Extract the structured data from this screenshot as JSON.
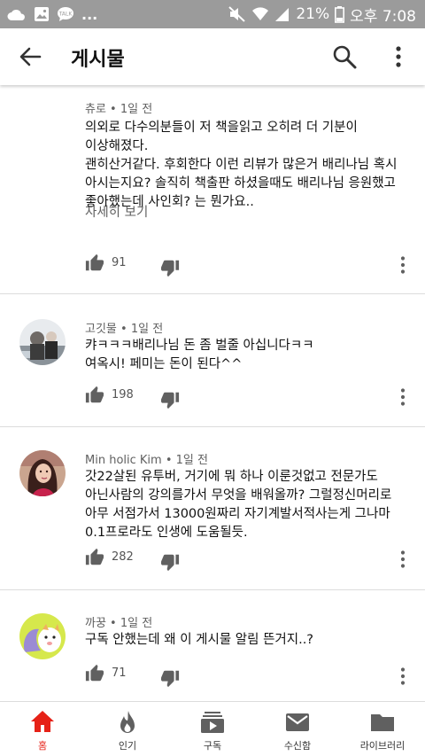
{
  "status_bar": {
    "battery": "21%",
    "time": "오후 7:08",
    "more": "..."
  },
  "app_bar": {
    "title": "게시물"
  },
  "comments": [
    {
      "author": "츄로",
      "time": "1일 전",
      "text": "의외로 다수의분들이 저 책을읽고 오히려 더 기분이\n이상해졌다.\n괜히산거같다. 후회한다 이런 리뷰가 많은거 배리나님 혹시\n아시는지요? 솔직히 책출판 하셨을때도 배리나님 응원했고\n좋아했는데 사인회? 는 뭔가요..",
      "read_more": "자세히 보기",
      "likes": "91"
    },
    {
      "author": "고깃물",
      "time": "1일 전",
      "text": "캬ㅋㅋㅋ배리나님 돈 좀 벌줄 아십니다ㅋㅋ\n여옥시! 페미는 돈이 된다^^",
      "likes": "198"
    },
    {
      "author": "Min holic Kim",
      "time": "1일 전",
      "text": "갓22살된 유투버, 거기에 뭐 하나 이룬것없고 전문가도\n아닌사람의 강의를가서 무엇을 배워올까? 그럴정신머리로\n아무 서점가서 13000원짜리 자기계발서적사는게 그나마\n0.1프로라도 인생에 도움될듯.",
      "likes": "282"
    },
    {
      "author": "까꿍",
      "time": "1일 전",
      "text": "구독 안했는데 왜 이 게시물 알림 뜬거지..?",
      "likes": "71"
    }
  ],
  "bottom_nav": {
    "items": [
      {
        "label": "홈",
        "icon": "home-icon",
        "active": true
      },
      {
        "label": "인기",
        "icon": "trending-icon",
        "active": false
      },
      {
        "label": "구독",
        "icon": "subscriptions-icon",
        "active": false
      },
      {
        "label": "수신함",
        "icon": "inbox-icon",
        "active": false
      },
      {
        "label": "라이브러리",
        "icon": "library-icon",
        "active": false
      }
    ]
  },
  "colors": {
    "status_bar": "#9b9b9b",
    "active_red": "#e62117",
    "icon_grey": "#606060",
    "divider": "#dcdcdc"
  }
}
